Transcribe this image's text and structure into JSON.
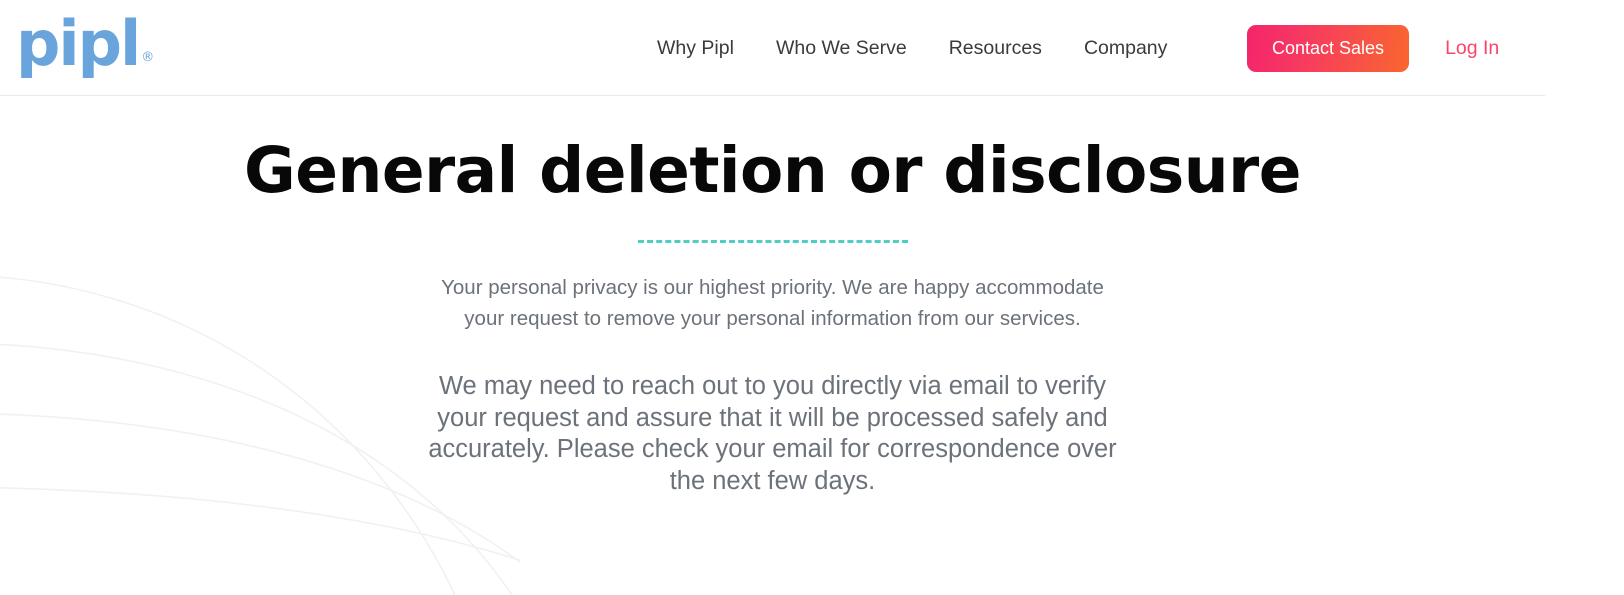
{
  "header": {
    "logo": {
      "text": "pipl",
      "registered_mark": "®",
      "color": "#6aa4dc",
      "icon": "pipl-logo"
    },
    "nav_items": [
      {
        "label": "Why Pipl"
      },
      {
        "label": "Who We Serve"
      },
      {
        "label": "Resources"
      },
      {
        "label": "Company"
      }
    ],
    "cta": {
      "label": "Contact Sales",
      "gradient_from": "#f4246c",
      "gradient_to": "#f9662f",
      "text_color": "#ffffff"
    },
    "login": {
      "label": "Log In",
      "color": "#f9456a"
    },
    "border_color": "#e9e9ea"
  },
  "hero": {
    "title": "General deletion or disclosure",
    "title_color": "#080808",
    "divider": {
      "style": "dashed",
      "color": "#4ecdc4"
    },
    "lead_paragraph": "Your personal privacy is our highest priority. We are happy accommodate your request to remove your personal information from our services.",
    "secondary_paragraph": "We may need to reach out to you directly via email to verify your request and assure that it will be processed safely and accurately. Please check your email for correspondence over the next few days.",
    "body_text_color": "#6c727a"
  },
  "decor": {
    "arcs_label": "background-arcs",
    "arc_color": "#f1f1f2",
    "arc_count": 4
  },
  "page": {
    "background": "#ffffff"
  }
}
